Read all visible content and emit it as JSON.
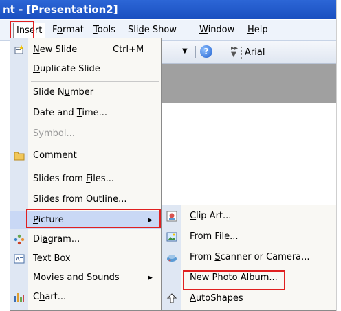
{
  "window": {
    "title": "nt - [Presentation2]"
  },
  "menubar": {
    "items": [
      {
        "label": "Insert",
        "ul": "I",
        "rest": "nsert"
      },
      {
        "label": "Format",
        "ul": "o",
        "pre": "F",
        "rest": "rmat"
      },
      {
        "label": "Tools",
        "ul": "T",
        "rest": "ools"
      },
      {
        "label": "Slide Show",
        "pre": "Sli",
        "ul": "d",
        "rest": "e Show"
      },
      {
        "label": "Window",
        "ul": "W",
        "rest": "indow"
      },
      {
        "label": "Help",
        "ul": "H",
        "rest": "elp"
      }
    ]
  },
  "toolbar": {
    "font_name": "Arial",
    "help_glyph": "?"
  },
  "insert_menu": {
    "items": [
      {
        "pre": "",
        "ul": "N",
        "rest": "ew Slide",
        "shortcut": "Ctrl+M"
      },
      {
        "pre": "",
        "ul": "D",
        "rest": "uplicate Slide"
      },
      {
        "pre": "Slide N",
        "ul": "u",
        "rest": "mber"
      },
      {
        "pre": "Date and ",
        "ul": "T",
        "rest": "ime..."
      },
      {
        "pre": "",
        "ul": "S",
        "rest": "ymbol..."
      },
      {
        "pre": "Co",
        "ul": "m",
        "rest": "ment"
      },
      {
        "pre": "Slides from ",
        "ul": "F",
        "rest": "iles..."
      },
      {
        "pre": "Slides from Outl",
        "ul": "i",
        "rest": "ne..."
      },
      {
        "pre": "",
        "ul": "P",
        "rest": "icture"
      },
      {
        "pre": "Di",
        "ul": "a",
        "rest": "gram..."
      },
      {
        "pre": "Te",
        "ul": "x",
        "rest": "t Box"
      },
      {
        "pre": "Mo",
        "ul": "v",
        "rest": "ies and Sounds"
      },
      {
        "pre": "C",
        "ul": "h",
        "rest": "art..."
      }
    ]
  },
  "picture_submenu": {
    "items": [
      {
        "pre": "",
        "ul": "C",
        "rest": "lip Art..."
      },
      {
        "pre": "",
        "ul": "F",
        "rest": "rom File..."
      },
      {
        "pre": "From ",
        "ul": "S",
        "rest": "canner or Camera..."
      },
      {
        "pre": "New ",
        "ul": "P",
        "rest": "hoto Album..."
      },
      {
        "pre": "",
        "ul": "A",
        "rest": "utoShapes"
      }
    ]
  }
}
